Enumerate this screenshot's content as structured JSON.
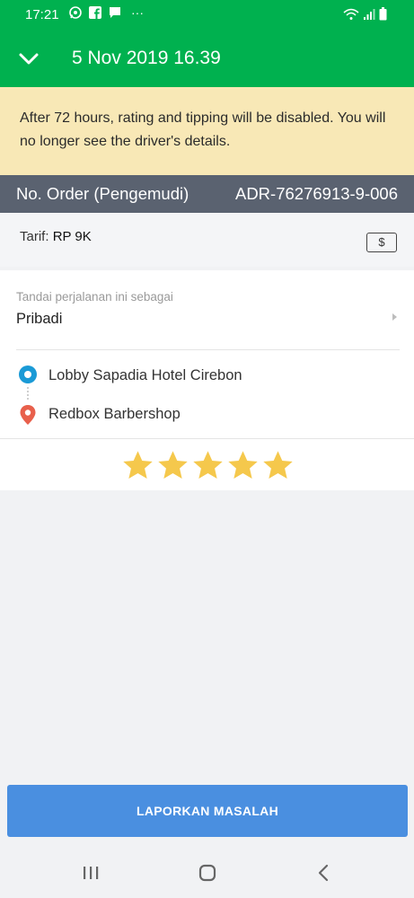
{
  "status_bar": {
    "time": "17:21",
    "more": "···",
    "icons": [
      "whatsapp-icon",
      "facebook-icon",
      "chat-icon",
      "wifi-icon",
      "signal-icon",
      "battery-icon"
    ]
  },
  "header": {
    "title": "5 Nov 2019 16.39"
  },
  "notice": {
    "text": "After 72 hours, rating and tipping will be disabled. You will no longer see the driver's details."
  },
  "order": {
    "label": "No. Order (Pengemudi)",
    "value": "ADR-76276913-9-006"
  },
  "fare": {
    "label": "Tarif:",
    "amount": "RP 9K",
    "payment_symbol": "$"
  },
  "trip": {
    "mark_label": "Tandai perjalanan ini sebagai",
    "mark_value": "Pribadi",
    "pickup": "Lobby Sapadia Hotel Cirebon",
    "dropoff": "Redbox Barbershop"
  },
  "rating": {
    "stars": 5,
    "max": 5,
    "star_color": "#f5c84c"
  },
  "actions": {
    "report": "LAPORKAN MASALAH"
  },
  "colors": {
    "brand": "#00b14f",
    "notice_bg": "#f8e8b6",
    "order_bar": "#5a6270",
    "button": "#4a8fe0",
    "pickup": "#1a9ad6",
    "dropoff": "#e8604c"
  }
}
